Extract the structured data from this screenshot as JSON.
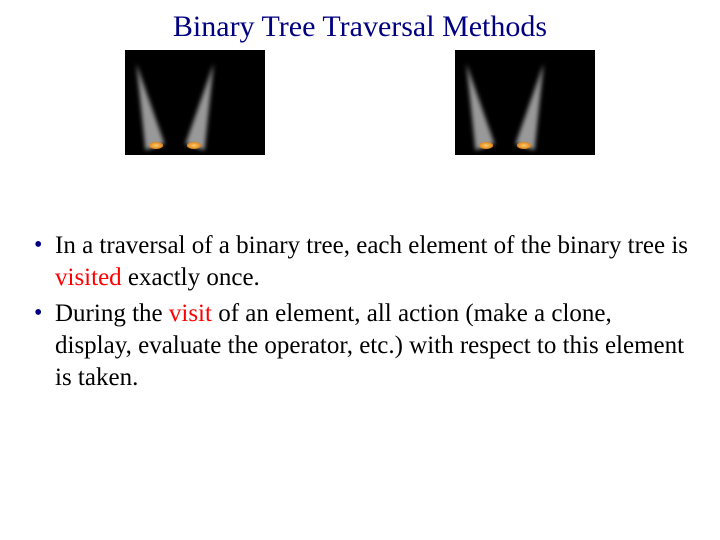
{
  "title": "Binary Tree Traversal Methods",
  "bullets": [
    {
      "pre": "In a traversal of a binary tree, each element of the binary tree is ",
      "highlight": "visited",
      "post": " exactly once."
    },
    {
      "pre": "During the ",
      "highlight": "visit",
      "post": " of an element, all action (make a clone, display, evaluate the operator, etc.) with respect to this element is taken."
    }
  ],
  "colors": {
    "title": "#000080",
    "highlight": "#ff0000",
    "bullet": "#000080"
  }
}
